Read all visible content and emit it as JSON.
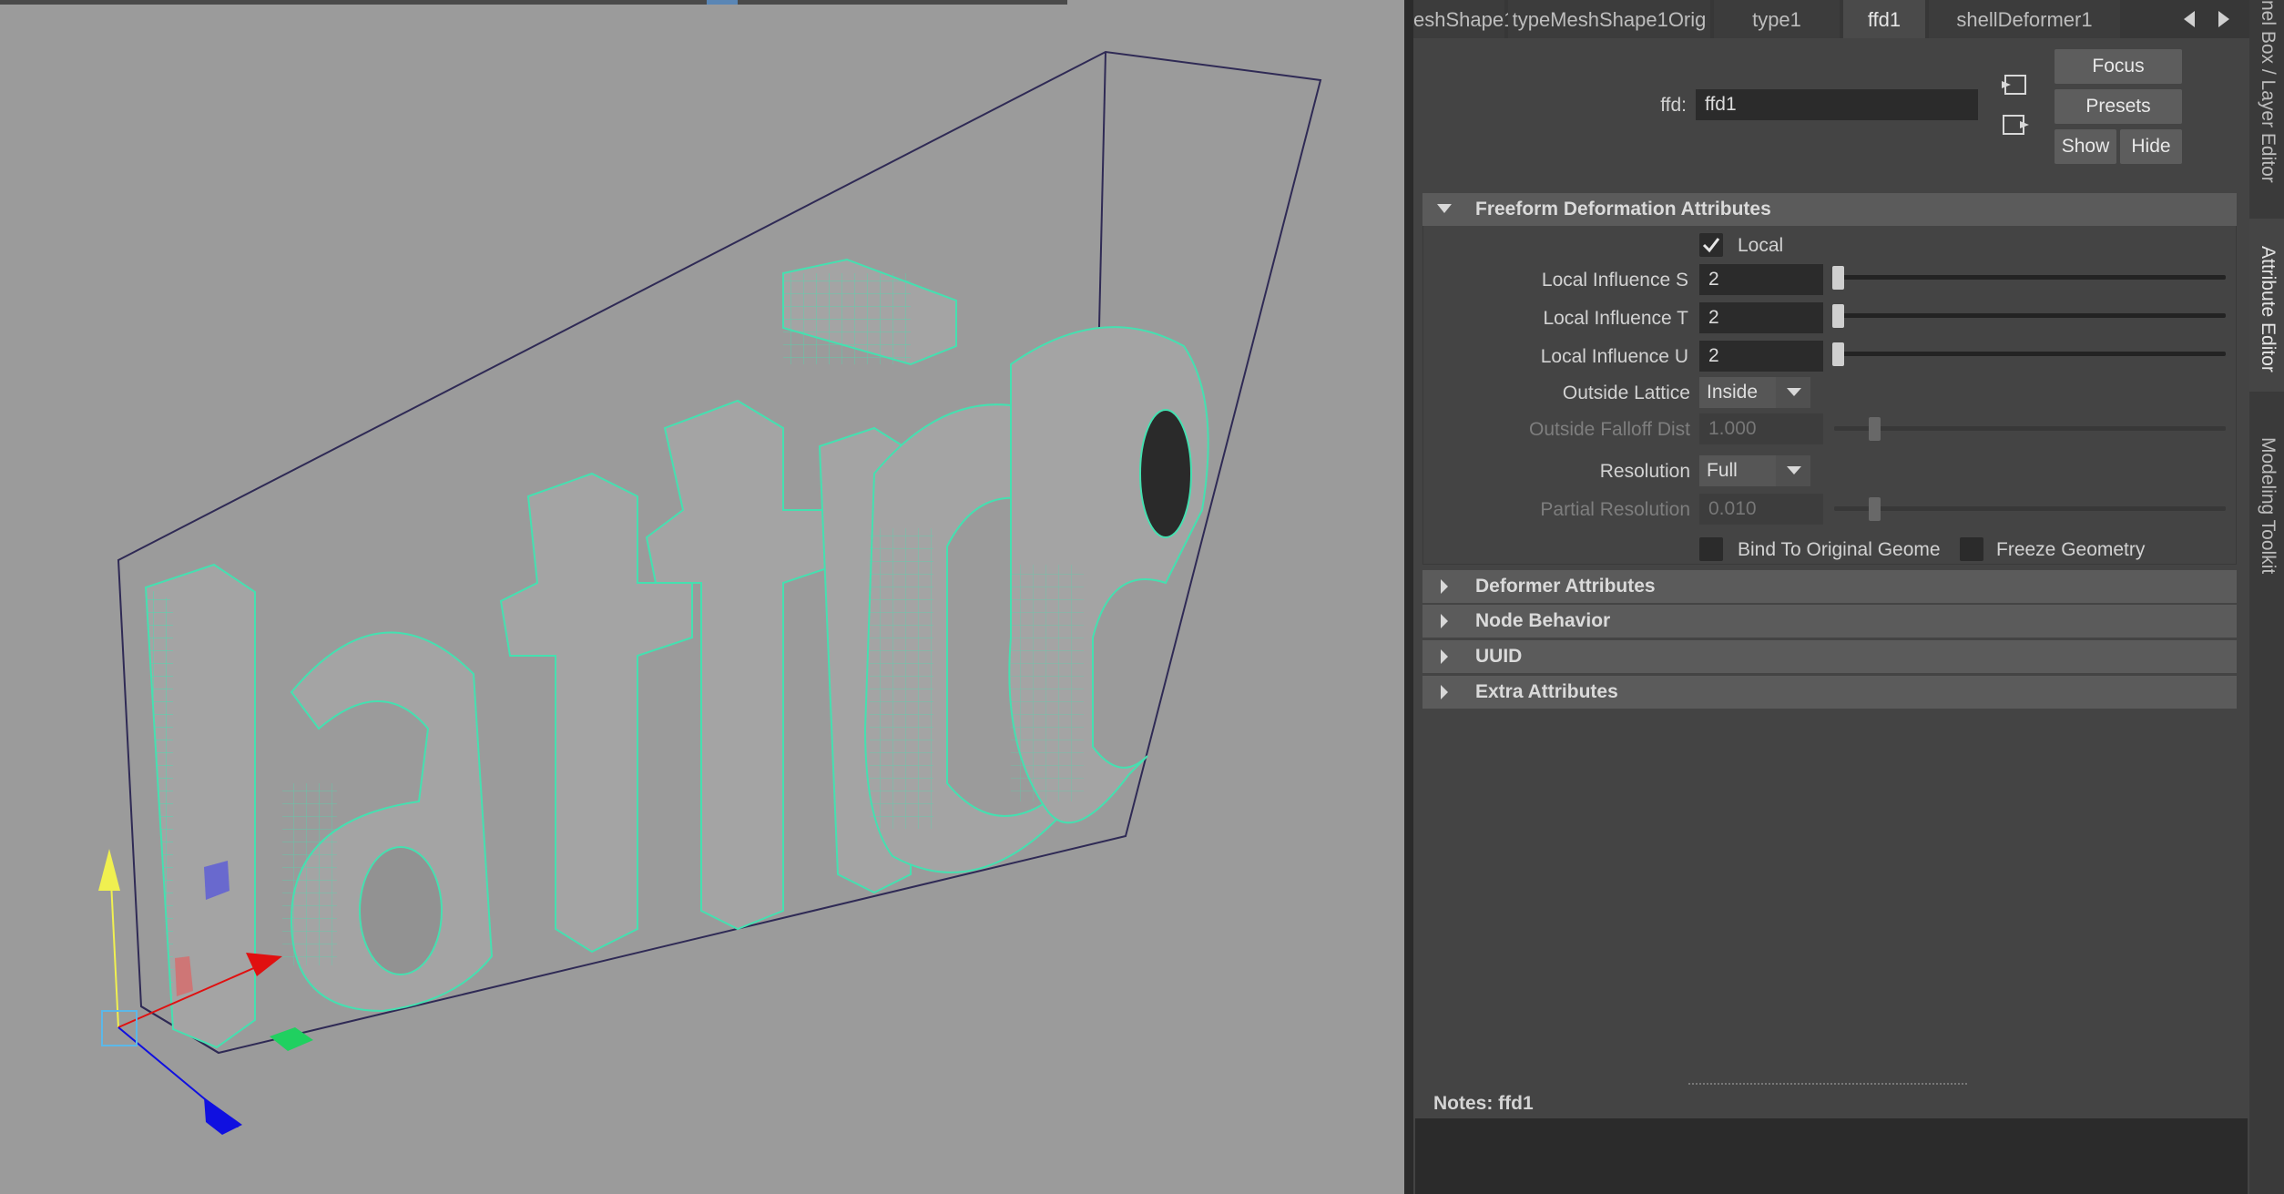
{
  "tabs": {
    "items": [
      {
        "label": "eshShape1",
        "active": false
      },
      {
        "label": "typeMeshShape1Orig",
        "active": false
      },
      {
        "label": "type1",
        "active": false
      },
      {
        "label": "ffd1",
        "active": true
      },
      {
        "label": "shellDeformer1",
        "active": false
      }
    ],
    "prev_icon": "triangle-left-icon",
    "next_icon": "triangle-right-icon"
  },
  "node": {
    "label": "ffd:",
    "value": "ffd1"
  },
  "buttons": {
    "focus": "Focus",
    "presets": "Presets",
    "show": "Show",
    "hide": "Hide"
  },
  "freeform": {
    "title": "Freeform Deformation Attributes",
    "expanded": true,
    "local_label": "Local",
    "local_checked": true,
    "influence_s_label": "Local Influence S",
    "influence_s_value": "2",
    "influence_t_label": "Local Influence T",
    "influence_t_value": "2",
    "influence_u_label": "Local Influence U",
    "influence_u_value": "2",
    "outside_lattice_label": "Outside Lattice",
    "outside_lattice_value": "Inside",
    "outside_falloff_label": "Outside Falloff Dist",
    "outside_falloff_value": "1.000",
    "resolution_label": "Resolution",
    "resolution_value": "Full",
    "partial_resolution_label": "Partial Resolution",
    "partial_resolution_value": "0.010",
    "bind_label": "Bind To Original Geome",
    "bind_checked": false,
    "freeze_label": "Freeze Geometry",
    "freeze_checked": false
  },
  "sections": [
    {
      "title": "Deformer Attributes",
      "expanded": false
    },
    {
      "title": "Node Behavior",
      "expanded": false
    },
    {
      "title": "UUID",
      "expanded": false
    },
    {
      "title": "Extra Attributes",
      "expanded": false
    }
  ],
  "notes": {
    "label": "Notes:  ffd1",
    "value": ""
  },
  "side_tabs": [
    {
      "label": "nel Box / Layer Editor",
      "active": false
    },
    {
      "label": "Attribute Editor",
      "active": true
    },
    {
      "label": "Modeling Toolkit",
      "active": false
    }
  ],
  "viewport": {
    "text_object": "lattice",
    "colors": {
      "background": "#9b9b9b",
      "wireframe": "#45e0b0",
      "lattice": "#2f2a55",
      "axis_x": "#e01010",
      "axis_y": "#f0f050",
      "axis_z": "#1010e0",
      "plane_green": "#20d060"
    }
  }
}
